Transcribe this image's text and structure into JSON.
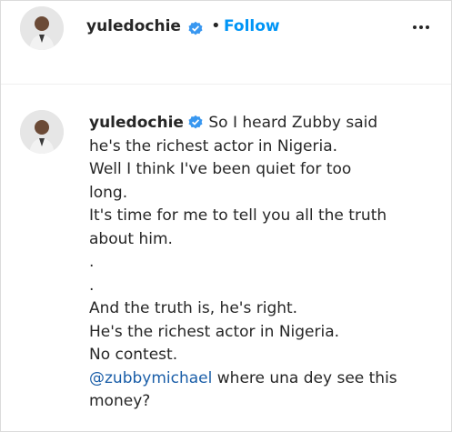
{
  "header": {
    "username": "yuledochie",
    "separator": "•",
    "follow_label": "Follow",
    "more_icon": "more-horizontal-icon",
    "verified_color": "#3897f0"
  },
  "comment": {
    "username": "yuledochie",
    "first_line": "So I heard Zubby said",
    "lines": [
      "he's the richest actor in Nigeria.",
      "Well I think I've been quiet for too",
      "long.",
      "It's time for me to tell you all the truth",
      "about him.",
      ".",
      ".",
      "And the truth is, he's right.",
      "He's the richest actor in Nigeria.",
      "No contest."
    ],
    "mention": "@zubbymichael",
    "mention_rest": " where una dey see this",
    "last_line": "money?"
  },
  "colors": {
    "accent": "#0095f6",
    "mention": "#1a5ea8",
    "text": "#262626"
  }
}
